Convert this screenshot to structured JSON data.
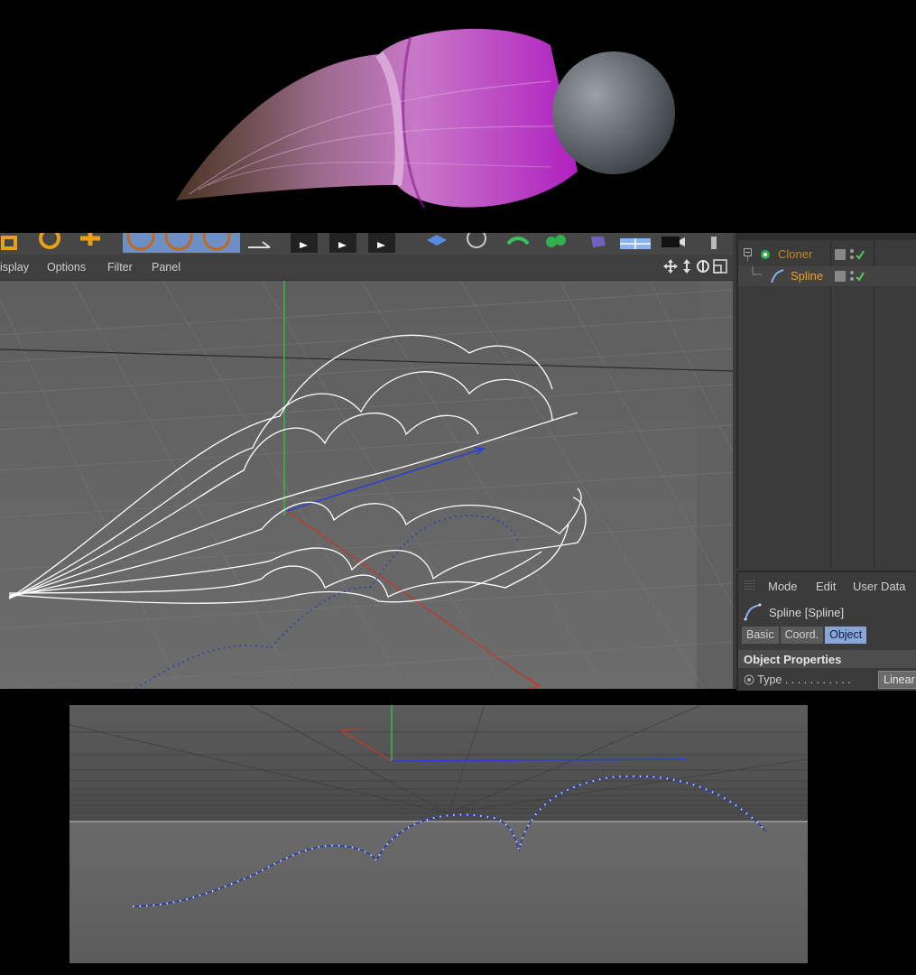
{
  "viewport_menu": {
    "items": [
      "isplay",
      "Options",
      "Filter",
      "Panel"
    ]
  },
  "object_manager": {
    "objects": [
      {
        "name": "Cloner",
        "icon": "cloner-icon"
      },
      {
        "name": "Spline",
        "icon": "spline-icon"
      }
    ]
  },
  "attribute_manager": {
    "menu": [
      "Mode",
      "Edit",
      "User Data"
    ],
    "title": "Spline [Spline]",
    "tabs": [
      "Basic",
      "Coord.",
      "Object"
    ],
    "active_tab": "Object",
    "section_title": "Object Properties",
    "type_label": "Type . . . . . . . . . . .",
    "type_value": "Linear"
  },
  "colors": {
    "panel_bg": "#3a3a3a",
    "object_name": "#f0a020",
    "active_tab": "#8aa6d8",
    "axis_x": "#c0392b",
    "axis_y": "#2ecc40",
    "axis_z": "#2b3fd6",
    "spline_points": "#2b3fa8"
  }
}
